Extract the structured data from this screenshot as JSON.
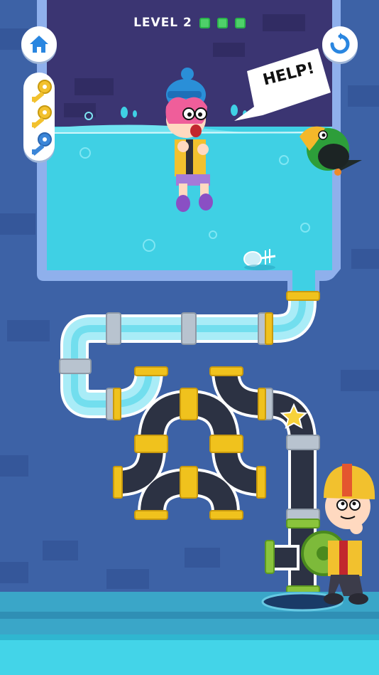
{
  "level": {
    "label": "LEVEL 2",
    "stars_total": 3,
    "stars_earned": 3,
    "pip_color": "#4fd06a"
  },
  "buttons": {
    "home": "home-icon",
    "restart": "restart-icon"
  },
  "keys": {
    "gold_count": 2,
    "blue_count": 1,
    "gold_color": "#f2c12e",
    "blue_color": "#3b86d8"
  },
  "speech": {
    "text": "HELP!"
  },
  "colors": {
    "water": "#3fd0e4",
    "tank_wall": "#8fb0ec",
    "tank_bg": "#3b3572",
    "pipe_dark": "#2c3243",
    "pipe_clear": "#a9ecf7",
    "joint_gold": "#f0c21d",
    "joint_silver": "#b8c3cf",
    "joint_green": "#8ac43c",
    "floor": "#3aa6c8"
  }
}
